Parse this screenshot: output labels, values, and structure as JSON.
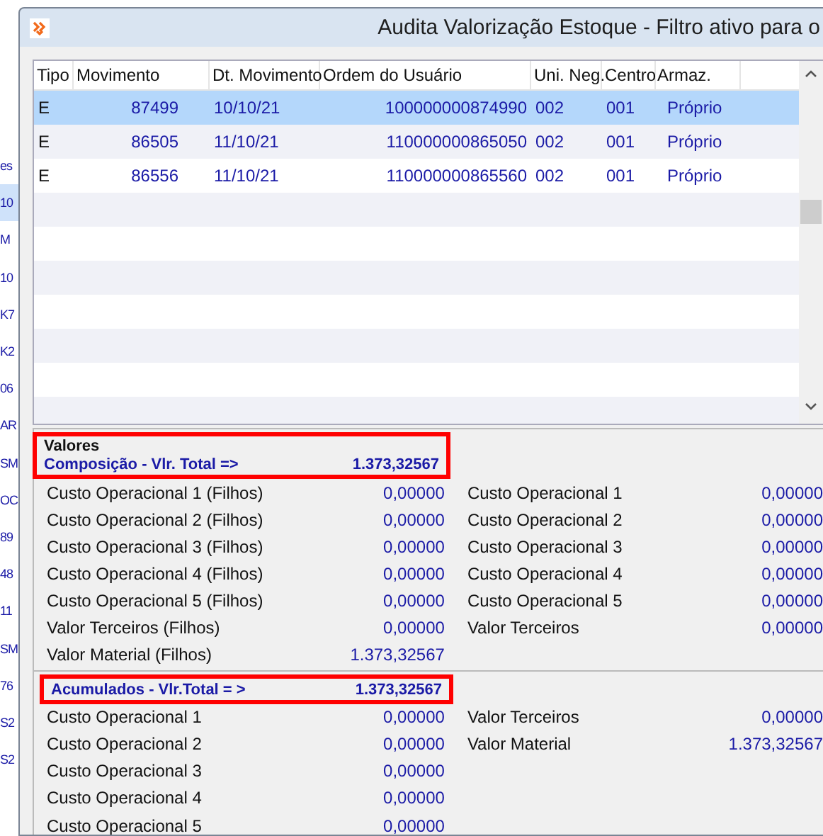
{
  "background_window": {
    "fragments": [
      {
        "text": "es",
        "selected": false
      },
      {
        "text": "10",
        "selected": true
      },
      {
        "text": "M",
        "selected": false
      },
      {
        "text": "10",
        "selected": false
      },
      {
        "text": "K7",
        "selected": false
      },
      {
        "text": "K2",
        "selected": false
      },
      {
        "text": "06",
        "selected": false
      },
      {
        "text": "AR",
        "selected": false
      },
      {
        "text": "SM",
        "selected": false
      },
      {
        "text": "OC",
        "selected": false
      },
      {
        "text": "89",
        "selected": false
      },
      {
        "text": "48",
        "selected": false
      },
      {
        "text": "11",
        "selected": false
      },
      {
        "text": "SM",
        "selected": false
      },
      {
        "text": "76",
        "selected": false
      },
      {
        "text": "S2",
        "selected": false
      },
      {
        "text": "S2",
        "selected": false
      }
    ]
  },
  "window": {
    "title": "Audita Valorização Estoque - Filtro ativo para o"
  },
  "table": {
    "columns": [
      "Tipo",
      "Movimento",
      "Dt. Movimento",
      "Ordem do Usuário",
      "Uni. Neg.",
      "Centro",
      "Armaz."
    ],
    "rows": [
      {
        "cells": [
          "E",
          "87499",
          "10/10/21",
          "100000000874990",
          "002",
          "001",
          "Próprio"
        ],
        "selected": true
      },
      {
        "cells": [
          "E",
          "86505",
          "11/10/21",
          "110000000865050",
          "002",
          "001",
          "Próprio"
        ],
        "selected": false
      },
      {
        "cells": [
          "E",
          "86556",
          "11/10/21",
          "110000000865560",
          "002",
          "001",
          "Próprio"
        ],
        "selected": false
      }
    ]
  },
  "values": {
    "title": "Valores",
    "composition": {
      "label": "Composição - Vlr. Total =>",
      "total": "1.373,32567",
      "left": [
        {
          "label": "Custo Operacional 1 (Filhos)",
          "value": "0,00000"
        },
        {
          "label": "Custo Operacional 2 (Filhos)",
          "value": "0,00000"
        },
        {
          "label": "Custo Operacional 3 (Filhos)",
          "value": "0,00000"
        },
        {
          "label": "Custo Operacional 4 (Filhos)",
          "value": "0,00000"
        },
        {
          "label": "Custo Operacional 5 (Filhos)",
          "value": "0,00000"
        },
        {
          "label": "Valor Terceiros (Filhos)",
          "value": "0,00000"
        },
        {
          "label": "Valor Material (Filhos)",
          "value": "1.373,32567"
        }
      ],
      "right": [
        {
          "label": "Custo Operacional 1",
          "value": "0,00000"
        },
        {
          "label": "Custo Operacional 2",
          "value": "0,00000"
        },
        {
          "label": "Custo Operacional 3",
          "value": "0,00000"
        },
        {
          "label": "Custo Operacional 4",
          "value": "0,00000"
        },
        {
          "label": "Custo Operacional 5",
          "value": "0,00000"
        },
        {
          "label": "Valor Terceiros",
          "value": "0,00000"
        }
      ]
    },
    "accumulated": {
      "label": "Acumulados - Vlr.Total = >",
      "total": "1.373,32567",
      "left": [
        {
          "label": "Custo Operacional 1",
          "value": "0,00000"
        },
        {
          "label": "Custo Operacional 2",
          "value": "0,00000"
        },
        {
          "label": "Custo Operacional 3",
          "value": "0,00000"
        },
        {
          "label": "Custo Operacional 4",
          "value": "0,00000"
        },
        {
          "label": "Custo Operacional 5",
          "value": "0,00000"
        }
      ],
      "right": [
        {
          "label": "Valor Terceiros",
          "value": "0,00000"
        },
        {
          "label": "Valor Material",
          "value": "1.373,32567"
        }
      ]
    }
  }
}
